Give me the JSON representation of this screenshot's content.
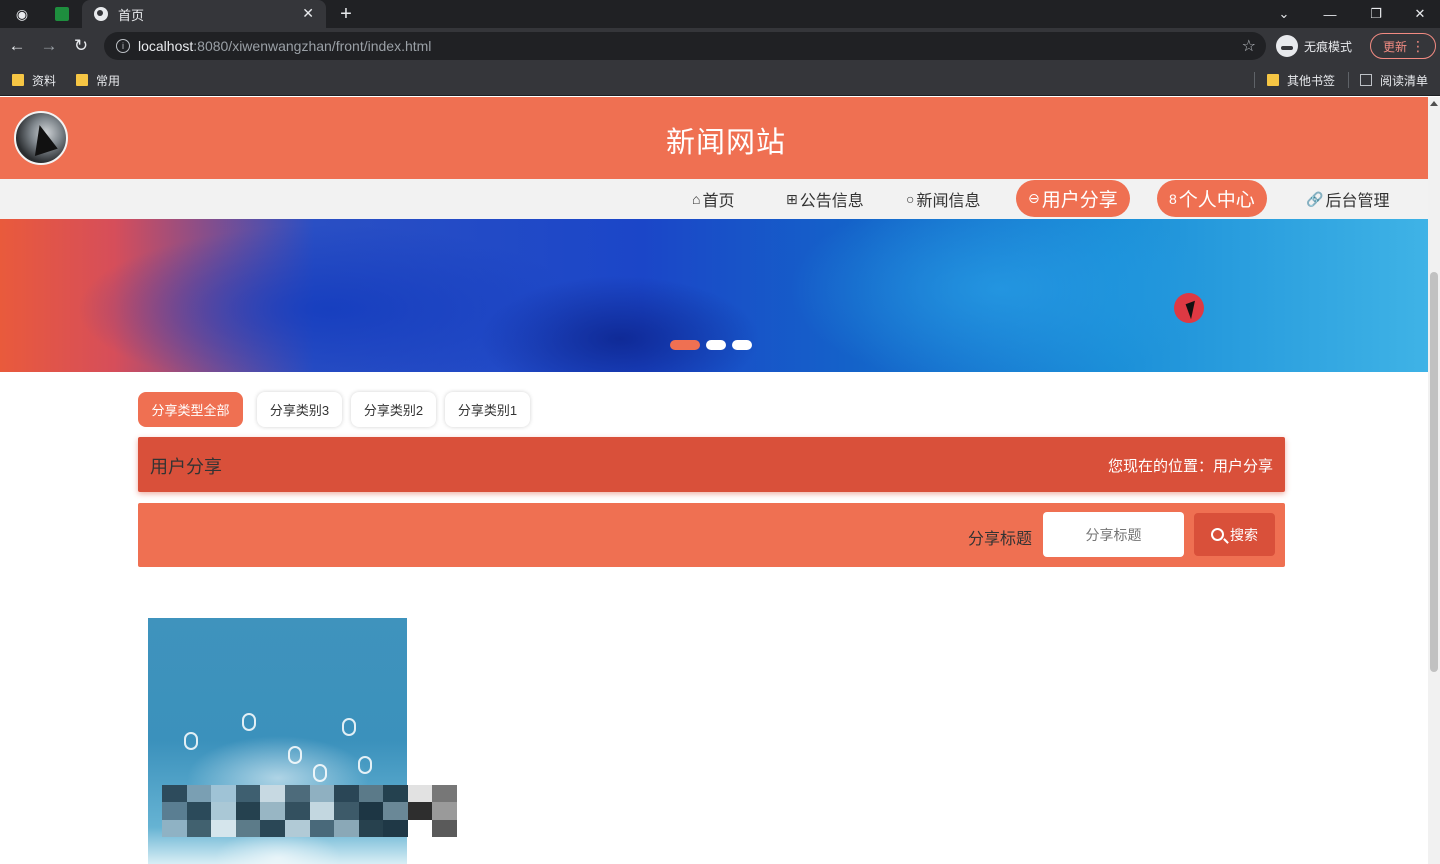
{
  "browser": {
    "active_tab_title": "首页",
    "url_host": "localhost",
    "url_path": ":8080/xiwenwangzhan/front/index.html",
    "incognito_label": "无痕模式",
    "update_label": "更新",
    "bookmarks": [
      "资料",
      "常用"
    ],
    "bookmarks_right": [
      "其他书签",
      "阅读清单"
    ]
  },
  "site": {
    "title": "新闻网站",
    "nav": [
      {
        "icon": "⌂",
        "label": "首页"
      },
      {
        "icon": "⊞",
        "label": "公告信息"
      },
      {
        "icon": "○",
        "label": "新闻信息"
      },
      {
        "icon": "⊖",
        "label": "用户分享"
      },
      {
        "icon": "8",
        "label": "个人中心"
      },
      {
        "icon": "🔗",
        "label": "后台管理"
      }
    ],
    "active_nav": "用户分享",
    "carousel": {
      "slides": 3,
      "active_index": 0
    }
  },
  "categories": [
    "分享类型全部",
    "分享类别3",
    "分享类别2",
    "分享类别1"
  ],
  "title_bar": {
    "left": "用户分享",
    "right": "您现在的位置：用户分享"
  },
  "search": {
    "label": "分享标题",
    "placeholder": "分享标题",
    "button": "搜索"
  },
  "colors": {
    "primary": "#ef7052",
    "primary_dark": "#d9503a"
  }
}
